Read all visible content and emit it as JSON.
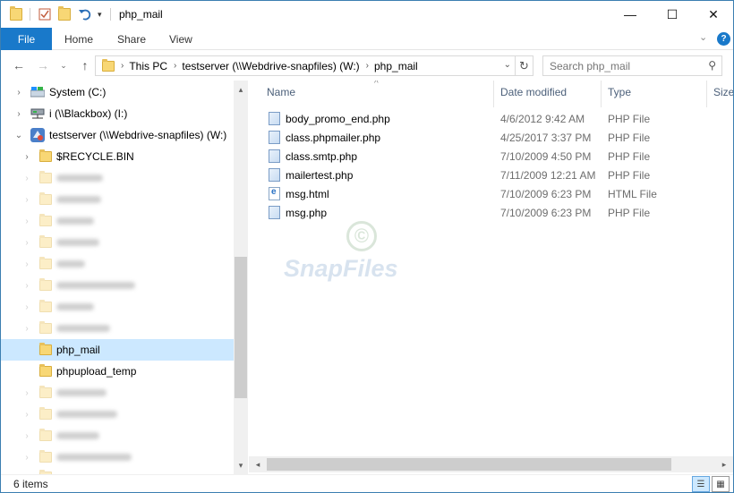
{
  "window": {
    "title": "php_mail",
    "controls": {
      "minimize": "—",
      "maximize": "☐",
      "close": "✕"
    }
  },
  "ribbon": {
    "tabs": [
      {
        "label": "File"
      },
      {
        "label": "Home"
      },
      {
        "label": "Share"
      },
      {
        "label": "View"
      }
    ]
  },
  "address": {
    "crumbs": [
      "This PC",
      "testserver (\\\\Webdrive-snapfiles) (W:)",
      "php_mail"
    ],
    "search_placeholder": "Search php_mail"
  },
  "nav_tree": {
    "items": [
      {
        "label": "System (C:)",
        "icon": "drive-icon",
        "expander": "right"
      },
      {
        "label": "i (\\\\Blackbox) (I:)",
        "icon": "network-drive-icon",
        "expander": "right"
      },
      {
        "label": "testserver (\\\\Webdrive-snapfiles) (W:)",
        "icon": "webdrive-icon",
        "expander": "down"
      },
      {
        "label": "$RECYCLE.BIN",
        "icon": "folder-icon",
        "expander": "right"
      },
      {
        "label": "php_mail",
        "icon": "folder-icon",
        "expander": "",
        "selected": true
      },
      {
        "label": "phpupload_temp",
        "icon": "folder-icon",
        "expander": ""
      }
    ]
  },
  "file_list": {
    "columns": {
      "name": "Name",
      "date": "Date modified",
      "type": "Type",
      "size": "Size"
    },
    "rows": [
      {
        "name": "body_promo_end.php",
        "date": "4/6/2012 9:42 AM",
        "type": "PHP File",
        "icon": "php-file-icon"
      },
      {
        "name": "class.phpmailer.php",
        "date": "4/25/2017 3:37 PM",
        "type": "PHP File",
        "icon": "php-file-icon"
      },
      {
        "name": "class.smtp.php",
        "date": "7/10/2009 4:50 PM",
        "type": "PHP File",
        "icon": "php-file-icon"
      },
      {
        "name": "mailertest.php",
        "date": "7/11/2009 12:21 AM",
        "type": "PHP File",
        "icon": "php-file-icon"
      },
      {
        "name": "msg.html",
        "date": "7/10/2009 6:23 PM",
        "type": "HTML File",
        "icon": "html-file-icon"
      },
      {
        "name": "msg.php",
        "date": "7/10/2009 6:23 PM",
        "type": "PHP File",
        "icon": "php-file-icon"
      }
    ]
  },
  "watermark": {
    "symbol": "©",
    "text": "SnapFiles"
  },
  "status": {
    "item_count": "6 items"
  },
  "colors": {
    "accent": "#1979ca",
    "selection": "#cce8ff",
    "header_text": "#4c607a"
  }
}
